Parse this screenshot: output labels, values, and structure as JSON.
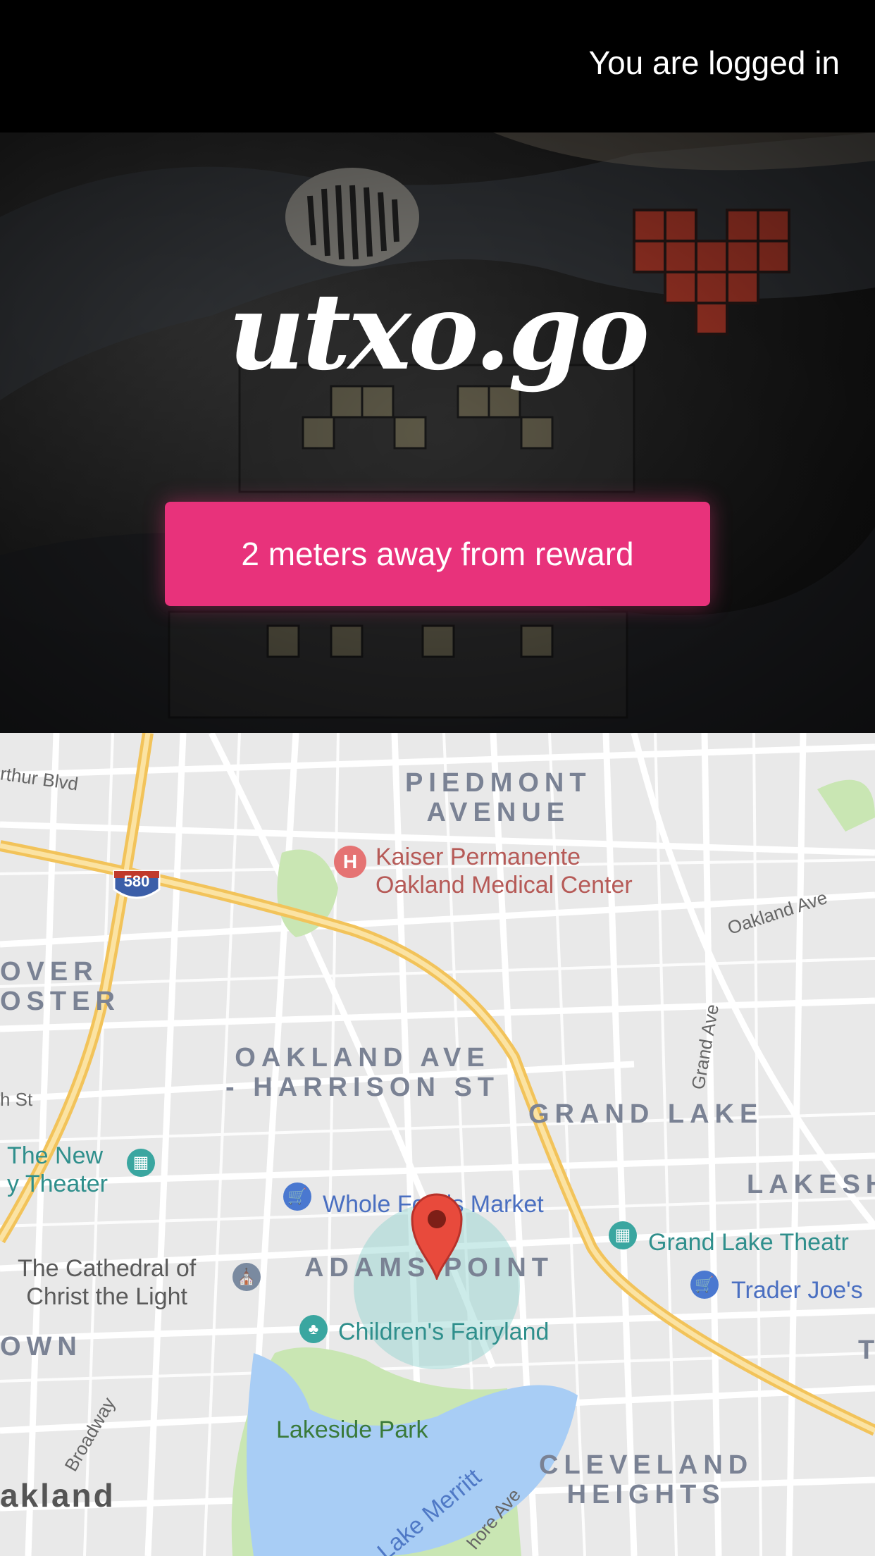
{
  "header": {
    "status_text": "You are logged in"
  },
  "hero": {
    "logo_text": "utxo.go",
    "reward_button_label": "2 meters away from reward"
  },
  "map": {
    "labels": {
      "arthur_blvd": "rthur Blvd",
      "piedmont": "PIEDMONT\nAVENUE",
      "kaiser": "Kaiser Permanente\nOakland Medical Center",
      "hwy_580": "580",
      "oakland_ave": "Oakland Ave",
      "hover_foster": "OVER\nOSTER",
      "grand_ave": "Grand Ave",
      "oakland_harrison": "OAKLAND AVE\n- HARRISON ST",
      "h_st": "h St",
      "grand_lake": "GRAND LAKE",
      "the_new_theater": "The New\ny Theater",
      "lakeshore": "LAKESH",
      "whole_foods": "Whole Foods Market",
      "grand_lake_theatre": "Grand Lake Theatr",
      "cathedral": "The Cathedral of\nChrist the Light",
      "adams_point": "ADAMS POINT",
      "trader_joes": "Trader Joe's",
      "childrens_fairyland": "Children's Fairyland",
      "downtown": "OWN",
      "t_edge": "T",
      "broadway": "Broadway",
      "lakeside_park": "Lakeside Park",
      "lake_merritt": "Lake Merritt",
      "shore_ave": "hore Ave",
      "cleveland_heights": "CLEVELAND\nHEIGHTS",
      "oakland": "akland"
    }
  },
  "colors": {
    "accent": "#e8327b",
    "highway": "#f7cd6b",
    "water": "#a8cdf5",
    "park": "#c9e6b3",
    "marker": "#e84a3c"
  }
}
